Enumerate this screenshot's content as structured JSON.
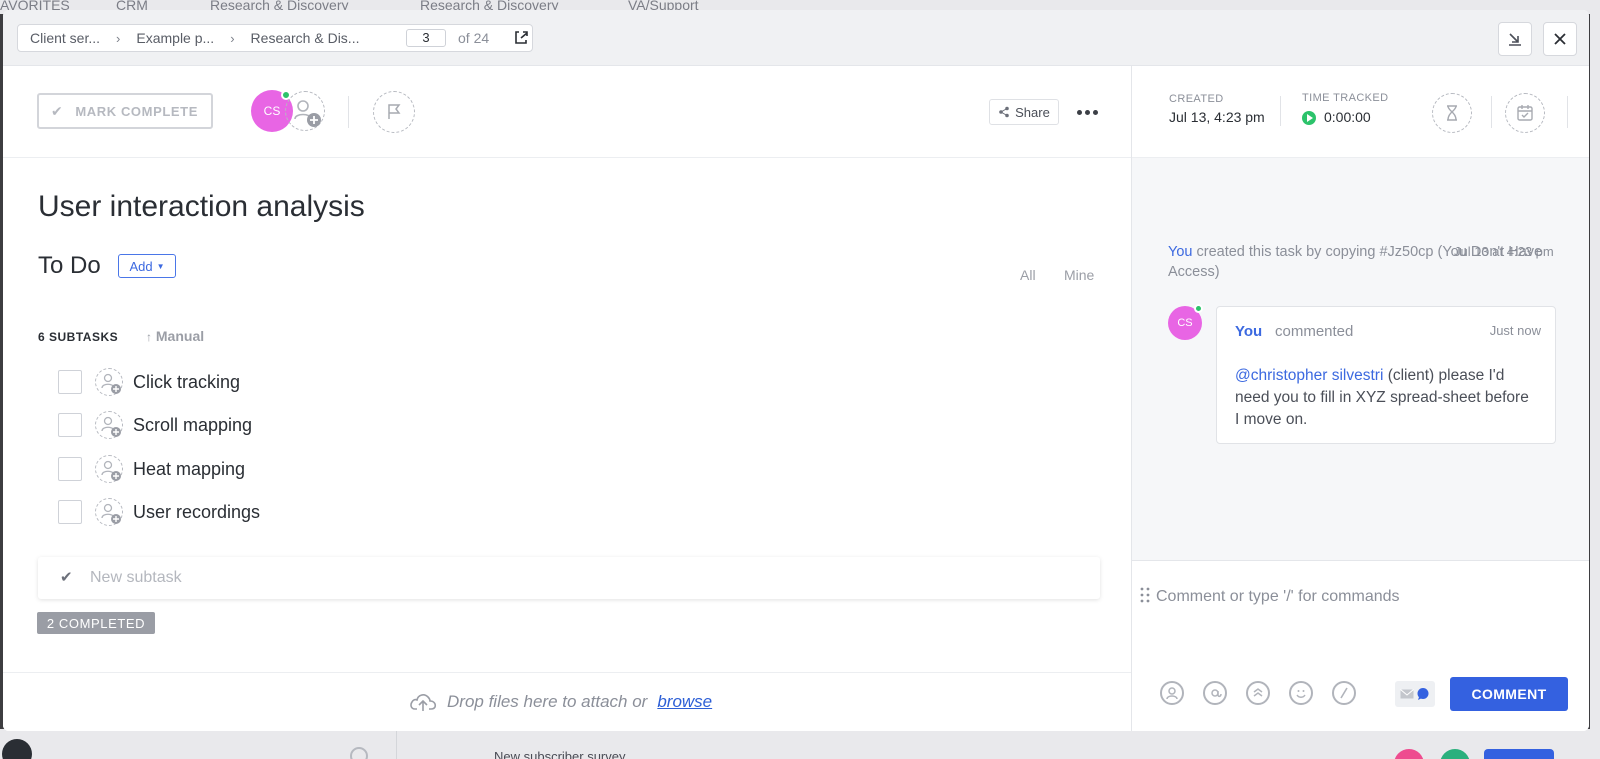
{
  "background": {
    "favorites_label": "AVORITES",
    "tabs": [
      "CRM",
      "Research & Discovery",
      "Research & Discovery",
      "VA/Support"
    ],
    "row_text": "New subscriber survey"
  },
  "breadcrumb": {
    "items": [
      "Client ser...",
      "Example p...",
      "Research & Dis..."
    ],
    "page_current": "3",
    "page_of": "of 24"
  },
  "task": {
    "mark_complete_label": "MARK COMPLETE",
    "assignee_initials": "CS",
    "share_label": "Share",
    "title": "User interaction analysis",
    "status": "To Do",
    "add_label": "Add",
    "filter_all": "All",
    "filter_mine": "Mine",
    "subtasks_count": "6 SUBTASKS",
    "sort_label": "Manual",
    "subtasks": [
      "Click tracking",
      "Scroll mapping",
      "Heat mapping",
      "User recordings"
    ],
    "new_subtask_placeholder": "New subtask",
    "completed_label": "2 COMPLETED",
    "drop_text": "Drop files here to attach or",
    "browse_label": "browse"
  },
  "meta": {
    "created_label": "CREATED",
    "created_value": "Jul 13, 4:23 pm",
    "time_tracked_label": "TIME TRACKED",
    "time_tracked_value": "0:00:00"
  },
  "activity": {
    "actor": "You",
    "text": "created this task by copying #Jz50cp (You Don't Have Access)",
    "time": "Jul 13 at 4:23 pm"
  },
  "comment": {
    "initials": "CS",
    "author": "You",
    "verb": "commented",
    "time": "Just now",
    "mention": "@christopher silvestri",
    "body": "(client) please I'd need you to fill in XYZ spread-sheet before I move on."
  },
  "composer": {
    "placeholder": "Comment or type '/' for commands",
    "submit_label": "COMMENT"
  },
  "colors": {
    "accent": "#3461e0",
    "avatar": "#e865e4",
    "online": "#2cc36b"
  }
}
